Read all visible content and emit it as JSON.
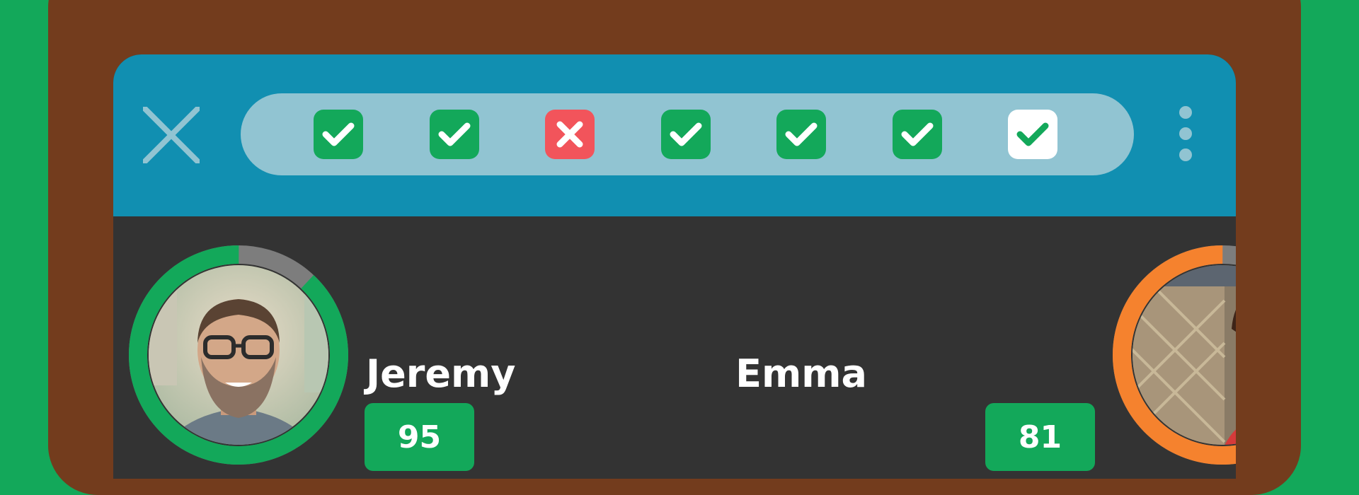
{
  "colors": {
    "background": "#13a85a",
    "frame": "#733c1d",
    "topbar": "#118fb1",
    "pill": "#91c4d2",
    "screen": "#333333",
    "correct": "#13a85a",
    "wrong": "#f2545b",
    "player1_ring": "#13a85a",
    "player2_ring": "#f5822e",
    "ring_remaining": "#7d7d7d"
  },
  "topbar": {
    "close_icon": "close-icon",
    "menu_icon": "more-vertical-icon"
  },
  "progress": {
    "questions": [
      {
        "state": "correct",
        "icon": "check-icon"
      },
      {
        "state": "correct",
        "icon": "check-icon"
      },
      {
        "state": "wrong",
        "icon": "x-icon"
      },
      {
        "state": "correct",
        "icon": "check-icon"
      },
      {
        "state": "correct",
        "icon": "check-icon"
      },
      {
        "state": "correct",
        "icon": "check-icon"
      },
      {
        "state": "current",
        "icon": "check-icon"
      }
    ]
  },
  "players": [
    {
      "name": "Jeremy",
      "score": "95",
      "timer_fraction": 0.88
    },
    {
      "name": "Emma",
      "score": "81",
      "timer_fraction": 0.82
    }
  ]
}
